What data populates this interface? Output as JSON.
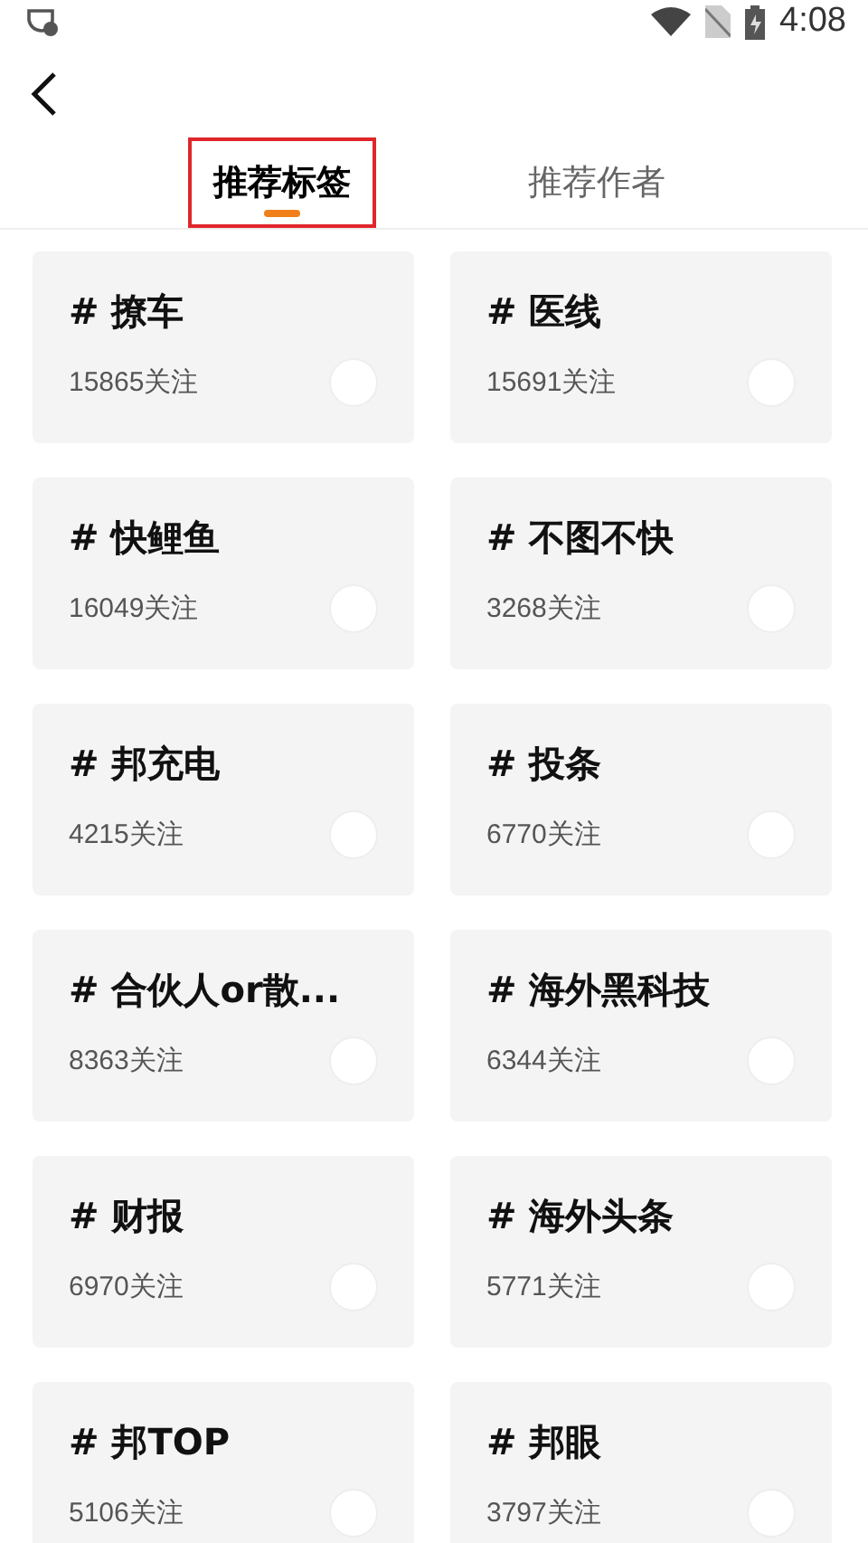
{
  "status_bar": {
    "time": "4:08"
  },
  "tabs": [
    {
      "label": "推荐标签",
      "selected": true,
      "highlighted": true
    },
    {
      "label": "推荐作者",
      "selected": false,
      "highlighted": false
    }
  ],
  "tags": [
    {
      "name": "# 撩车",
      "followers": "15865关注",
      "checked": false
    },
    {
      "name": "# 医线",
      "followers": "15691关注",
      "checked": false
    },
    {
      "name": "# 快鲤鱼",
      "followers": "16049关注",
      "checked": false
    },
    {
      "name": "# 不图不快",
      "followers": "3268关注",
      "checked": false
    },
    {
      "name": "# 邦充电",
      "followers": "4215关注",
      "checked": false
    },
    {
      "name": "# 投条",
      "followers": "6770关注",
      "checked": false
    },
    {
      "name": "# 合伙人or散...",
      "followers": "8363关注",
      "checked": false
    },
    {
      "name": "# 海外黑科技",
      "followers": "6344关注",
      "checked": false
    },
    {
      "name": "# 财报",
      "followers": "6970关注",
      "checked": false
    },
    {
      "name": "# 海外头条",
      "followers": "5771关注",
      "checked": false
    },
    {
      "name": "# 邦TOP",
      "followers": "5106关注",
      "checked": false
    },
    {
      "name": "# 邦眼",
      "followers": "3797关注",
      "checked": false
    }
  ]
}
